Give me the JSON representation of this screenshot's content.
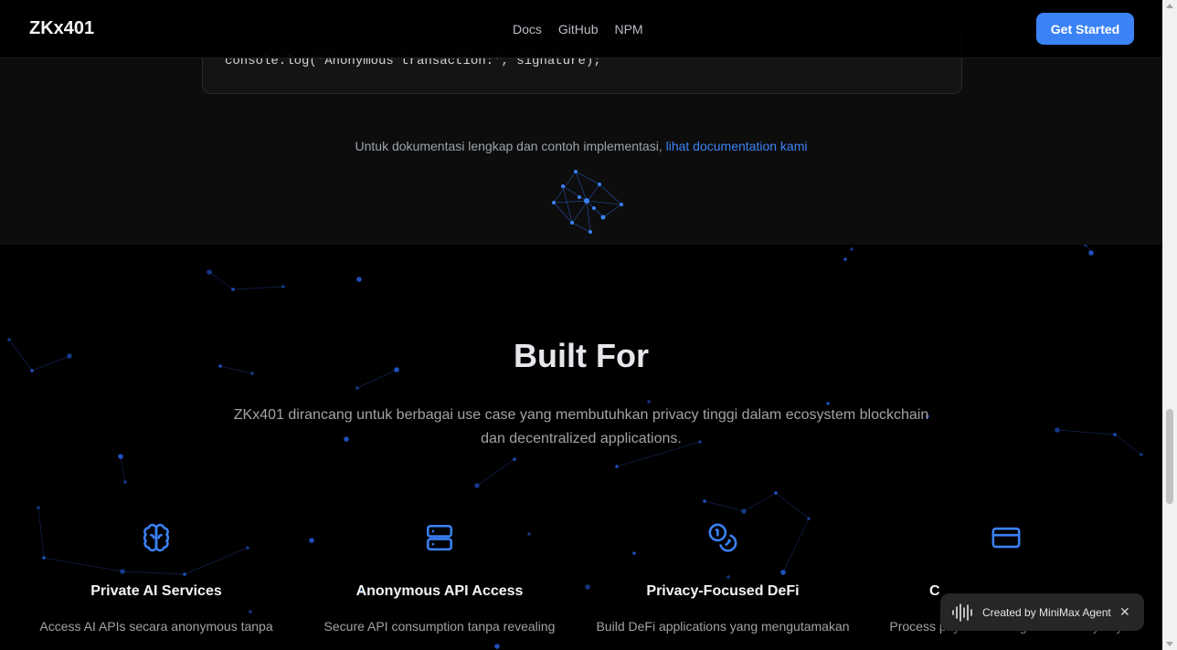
{
  "header": {
    "logo": "ZKx401",
    "nav": [
      "Docs",
      "GitHub",
      "NPM"
    ],
    "cta_label": "Get Started"
  },
  "docs": {
    "code_line": "console.log('Anonymous transaction:', signature);",
    "note_text": "Untuk dokumentasi lengkap dan contoh implementasi, ",
    "note_link": "lihat documentation kami"
  },
  "built_for": {
    "title": "Built For",
    "subtitle": "ZKx401 dirancang untuk berbagai use case yang membutuhkan privacy tinggi dalam ecosystem blockchain dan decentralized applications.",
    "cards": [
      {
        "icon": "brain-icon",
        "title": "Private AI Services",
        "desc": "Access AI APIs secara anonymous tanpa"
      },
      {
        "icon": "server-icon",
        "title": "Anonymous API Access",
        "desc": "Secure API consumption tanpa revealing"
      },
      {
        "icon": "coins-icon",
        "title": "Privacy-Focused DeFi",
        "desc": "Build DeFi applications yang mengutamakan"
      },
      {
        "icon": "credit-card-icon",
        "title": "C",
        "desc": "Process payments dengan full anonymity"
      }
    ]
  },
  "badge": {
    "label": "Created by MiniMax Agent",
    "close": "✕"
  },
  "colors": {
    "accent": "#3b82f6",
    "background": "#000000",
    "section_dark": "#0d0d0d"
  }
}
